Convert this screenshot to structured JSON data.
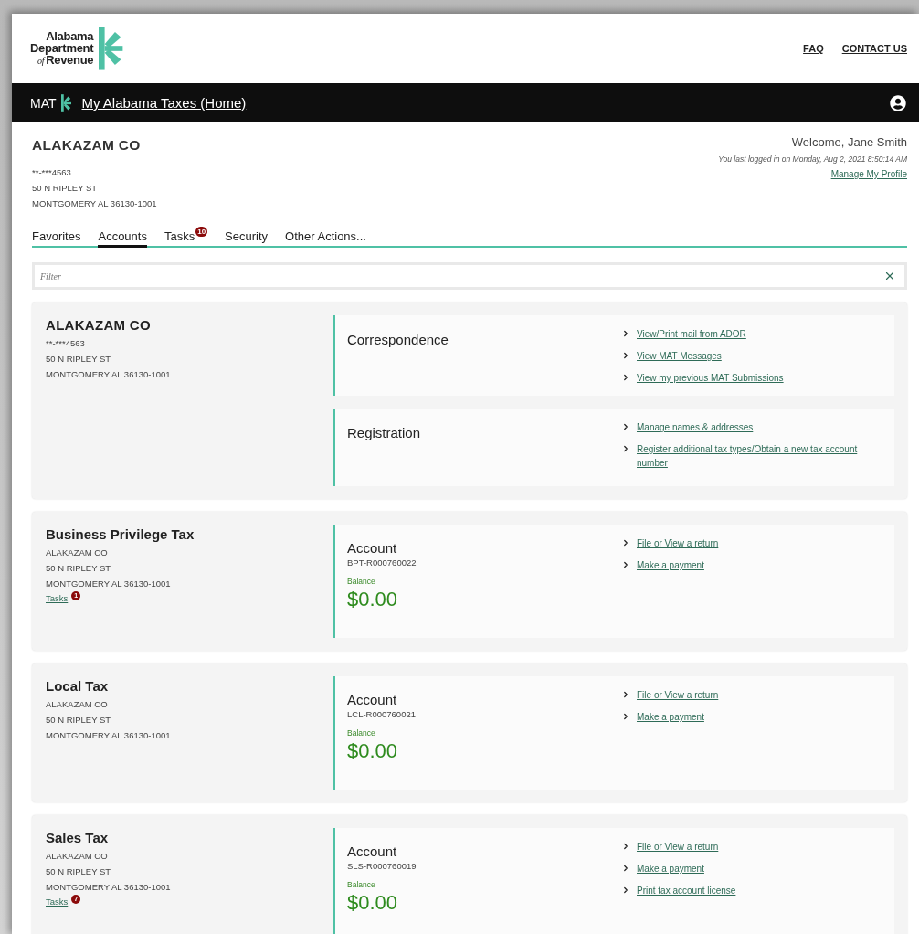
{
  "logo": {
    "line_1": "Alabama",
    "line_2": "Department",
    "line_3_prefix": "of",
    "line_3": "Revenue"
  },
  "header_links": [
    "FAQ",
    "CONTACT US"
  ],
  "nav": {
    "abbr": "MAT",
    "home_link": "My Alabama Taxes (Home)"
  },
  "profile": {
    "name": "ALAKAZAM CO",
    "masked_id": "**-***4563",
    "address": [
      "50 N RIPLEY ST",
      "MONTGOMERY AL 36130-1001"
    ],
    "welcome": "Welcome, Jane Smith",
    "last_login": "You last logged in on Monday, Aug 2, 2021 8:50:14 AM",
    "manage_link": "Manage My Profile"
  },
  "tabs": [
    {
      "label": "Favorites",
      "selected": false
    },
    {
      "label": "Accounts",
      "selected": true
    },
    {
      "label": "Tasks",
      "selected": false,
      "badge": "10"
    },
    {
      "label": "Security",
      "selected": false
    },
    {
      "label": "Other Actions...",
      "selected": false
    }
  ],
  "filter": {
    "placeholder": "Filter"
  },
  "accounts": [
    {
      "kind": "summary",
      "title": "ALAKAZAM CO",
      "lines": [
        "**-***4563",
        "50 N RIPLEY ST",
        "MONTGOMERY AL 36130-1001"
      ],
      "sections": [
        {
          "title": "Correspondence",
          "links": [
            "View/Print mail from ADOR",
            "View MAT Messages",
            "View my previous MAT Submissions"
          ]
        },
        {
          "title": "Registration",
          "links": [
            "Manage names & addresses",
            "Register additional tax types/Obtain a new tax account number"
          ]
        }
      ]
    },
    {
      "kind": "tax",
      "title": "Business Privilege Tax",
      "lines": [
        "ALAKAZAM CO",
        "50 N RIPLEY ST",
        "MONTGOMERY AL 36130-1001"
      ],
      "tasks": {
        "label": "Tasks",
        "count": "1"
      },
      "panel": {
        "title": "Account",
        "number": "BPT-R000760022",
        "balance_label": "Balance",
        "balance": "$0.00"
      },
      "links": [
        "File or View a return",
        "Make a payment"
      ]
    },
    {
      "kind": "tax",
      "title": "Local Tax",
      "lines": [
        "ALAKAZAM CO",
        "50 N RIPLEY ST",
        "MONTGOMERY AL 36130-1001"
      ],
      "panel": {
        "title": "Account",
        "number": "LCL-R000760021",
        "balance_label": "Balance",
        "balance": "$0.00"
      },
      "links": [
        "File or View a return",
        "Make a payment"
      ]
    },
    {
      "kind": "tax",
      "title": "Sales Tax",
      "lines": [
        "ALAKAZAM CO",
        "50 N RIPLEY ST",
        "MONTGOMERY AL 36130-1001"
      ],
      "tasks": {
        "label": "Tasks",
        "count": "7"
      },
      "panel": {
        "title": "Account",
        "number": "SLS-R000760019",
        "balance_label": "Balance",
        "balance": "$0.00"
      },
      "links": [
        "File or View a return",
        "Make a payment",
        "Print tax account license"
      ]
    }
  ]
}
